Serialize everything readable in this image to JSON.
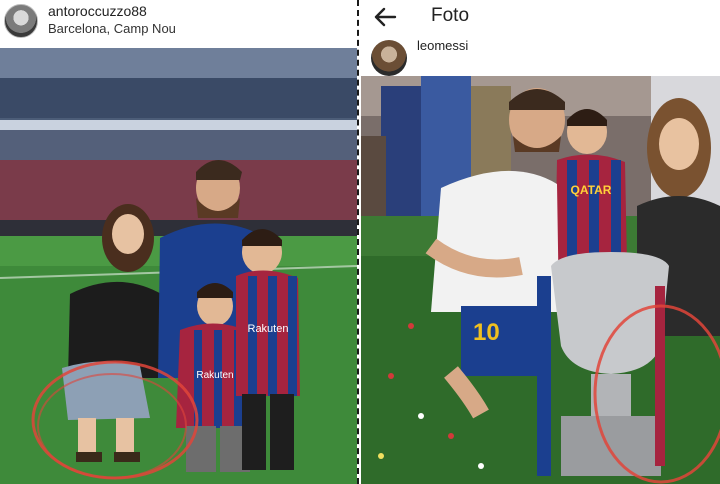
{
  "left_post": {
    "username": "antoroccuzzo88",
    "location": "Barcelona, Camp Nou",
    "jerseys": {
      "child_a_sponsor": "Rakuten",
      "child_b_sponsor": "Rakuten"
    }
  },
  "right_post": {
    "title": "Foto",
    "author": "leomessi",
    "jerseys": {
      "player_number": "10",
      "child_sponsor": "QATAR"
    }
  },
  "colors": {
    "annotation_circle": "#e0453a",
    "pitch_green": "#3e8a3a",
    "barca_blue": "#1b3f8f",
    "barca_garnet": "#a6243f"
  },
  "icons": {
    "back": "arrow-left-icon",
    "user_avatar": "avatar-icon"
  }
}
